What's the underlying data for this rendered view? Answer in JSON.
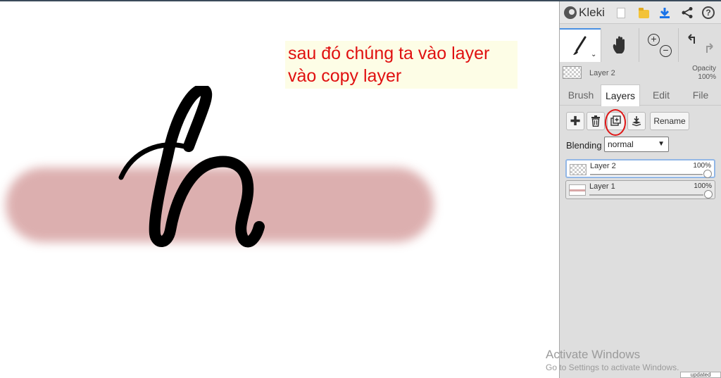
{
  "header": {
    "app_name": "Kleki",
    "icons": [
      "new-image-icon",
      "open-image-icon",
      "save-download-icon",
      "share-icon",
      "help-icon"
    ],
    "help_symbol": "?"
  },
  "tools": {
    "brush_chevron": "⌄",
    "zoom_in_symbol": "+",
    "zoom_out_symbol": "−"
  },
  "current_layer": {
    "name": "Layer 2",
    "opacity_label": "Opacity",
    "opacity_value": "100%"
  },
  "tabs": [
    {
      "label": "Brush"
    },
    {
      "label": "Layers"
    },
    {
      "label": "Edit"
    },
    {
      "label": "File"
    }
  ],
  "layer_tools": {
    "add_symbol": "✚",
    "rename_label": "Rename"
  },
  "blending": {
    "label": "Blending",
    "value": "normal"
  },
  "layers": [
    {
      "name": "Layer 2",
      "opacity": "100%",
      "active": true
    },
    {
      "name": "Layer 1",
      "opacity": "100%",
      "active": false
    }
  ],
  "canvas": {
    "annotation_line1": "sau đó chúng ta vào layer",
    "annotation_line2": "vào copy layer",
    "annotation_color": "#e01010",
    "stroke_color": "#d9a7a7"
  },
  "overlay": {
    "activate_title": "Activate Windows",
    "activate_sub": "Go to Settings to activate Windows.",
    "updated_label": "updated"
  },
  "colors": {
    "accent": "#4a90e2",
    "highlight_circle": "#e01515"
  }
}
